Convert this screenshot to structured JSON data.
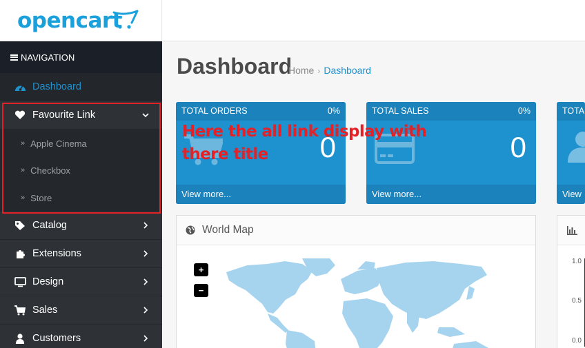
{
  "brand": {
    "logo_text": "opencart",
    "accent": "#1e91cf",
    "logo_color": "#1aa0db"
  },
  "navigation": {
    "header_label": "NAVIGATION",
    "items": [
      {
        "label": "Dashboard",
        "icon": "dashboard-icon",
        "active": true
      },
      {
        "label": "Favourite Link",
        "icon": "heart-icon",
        "expanded": true,
        "children": [
          "Apple Cinema",
          "Checkbox",
          "Store"
        ]
      },
      {
        "label": "Catalog",
        "icon": "tags-icon"
      },
      {
        "label": "Extensions",
        "icon": "puzzle-icon"
      },
      {
        "label": "Design",
        "icon": "monitor-icon"
      },
      {
        "label": "Sales",
        "icon": "cart-icon"
      },
      {
        "label": "Customers",
        "icon": "user-icon"
      }
    ]
  },
  "page": {
    "title": "Dashboard",
    "breadcrumb": [
      "Home",
      "Dashboard"
    ]
  },
  "tiles": [
    {
      "title": "TOTAL ORDERS",
      "percent": "0%",
      "value": "0",
      "footer": "View more...",
      "icon": "cart-icon"
    },
    {
      "title": "TOTAL SALES",
      "percent": "0%",
      "value": "0",
      "footer": "View more...",
      "icon": "credit-card-icon"
    },
    {
      "title": "TOTA",
      "footer": "View",
      "icon": "user-icon"
    }
  ],
  "world_map": {
    "title": "World Map",
    "zoom_in": "+",
    "zoom_out": "−"
  },
  "sales_chart": {
    "axis_ticks": [
      "1.0",
      "0.5",
      "0.0"
    ]
  },
  "annotation": {
    "text": "Here the all link display with there title",
    "color": "#e32126"
  }
}
